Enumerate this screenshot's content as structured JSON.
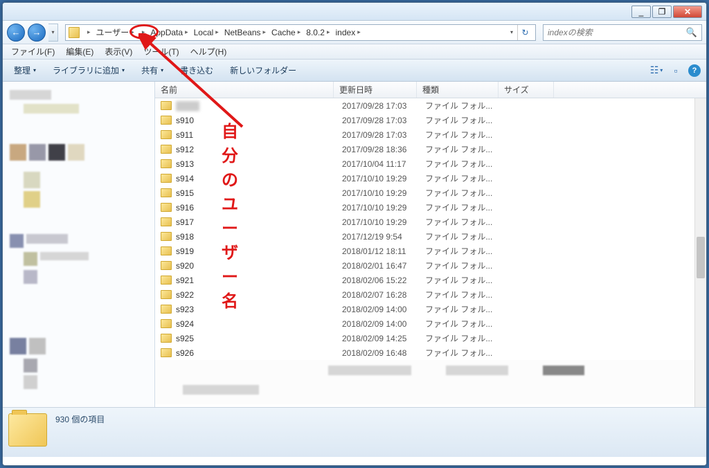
{
  "window": {
    "min": "_",
    "max": "❐",
    "close": "✕"
  },
  "breadcrumbs": [
    "ユーザー",
    "",
    "AppData",
    "Local",
    "NetBeans",
    "Cache",
    "8.0.2",
    "index"
  ],
  "search": {
    "placeholder": "indexの検索"
  },
  "menus": [
    "ファイル(F)",
    "編集(E)",
    "表示(V)",
    "ツール(T)",
    "ヘルプ(H)"
  ],
  "toolbar": {
    "organize": "整理",
    "library": "ライブラリに追加",
    "share": "共有",
    "burn": "書き込む",
    "newfolder": "新しいフォルダー"
  },
  "columns": {
    "name": "名前",
    "date": "更新日時",
    "type": "種類",
    "size": "サイズ"
  },
  "rows": [
    {
      "name": "s910",
      "date": "2017/09/28 17:03",
      "type": "ファイル フォル..."
    },
    {
      "name": "s911",
      "date": "2017/09/28 17:03",
      "type": "ファイル フォル..."
    },
    {
      "name": "s912",
      "date": "2017/09/28 18:36",
      "type": "ファイル フォル..."
    },
    {
      "name": "s913",
      "date": "2017/10/04 11:17",
      "type": "ファイル フォル..."
    },
    {
      "name": "s914",
      "date": "2017/10/10 19:29",
      "type": "ファイル フォル..."
    },
    {
      "name": "s915",
      "date": "2017/10/10 19:29",
      "type": "ファイル フォル..."
    },
    {
      "name": "s916",
      "date": "2017/10/10 19:29",
      "type": "ファイル フォル..."
    },
    {
      "name": "s917",
      "date": "2017/10/10 19:29",
      "type": "ファイル フォル..."
    },
    {
      "name": "s918",
      "date": "2017/12/19 9:54",
      "type": "ファイル フォル..."
    },
    {
      "name": "s919",
      "date": "2018/01/12 18:11",
      "type": "ファイル フォル..."
    },
    {
      "name": "s920",
      "date": "2018/02/01 16:47",
      "type": "ファイル フォル..."
    },
    {
      "name": "s921",
      "date": "2018/02/06 15:22",
      "type": "ファイル フォル..."
    },
    {
      "name": "s922",
      "date": "2018/02/07 16:28",
      "type": "ファイル フォル..."
    },
    {
      "name": "s923",
      "date": "2018/02/09 14:00",
      "type": "ファイル フォル..."
    },
    {
      "name": "s924",
      "date": "2018/02/09 14:00",
      "type": "ファイル フォル..."
    },
    {
      "name": "s925",
      "date": "2018/02/09 14:25",
      "type": "ファイル フォル..."
    },
    {
      "name": "s926",
      "date": "2018/02/09 16:48",
      "type": "ファイル フォル..."
    }
  ],
  "toprow": {
    "date": "2017/09/28 17:03",
    "type": "ファイル フォル..."
  },
  "status": {
    "count": "930 個の項目"
  },
  "annotation": {
    "label": "自分のユーザー名"
  }
}
